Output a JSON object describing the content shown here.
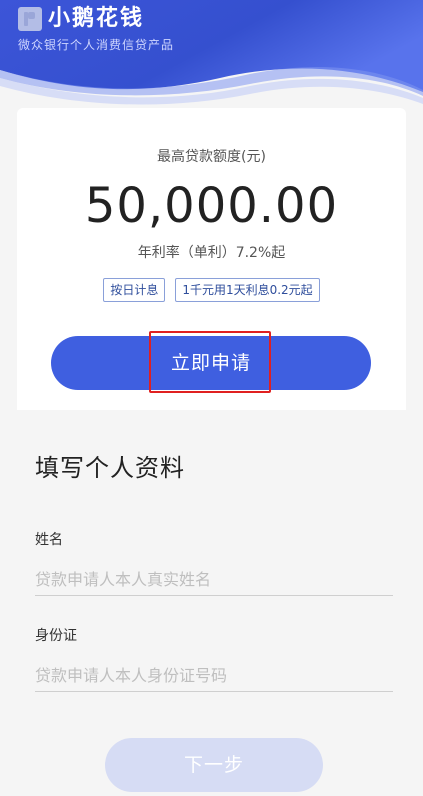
{
  "header": {
    "app_name": "小鹅花钱",
    "slogan": "微众银行个人消费信贷产品"
  },
  "loan_card": {
    "amount_label": "最高贷款额度(元)",
    "amount": "50,000.00",
    "rate_text": "年利率（单利）7.2%起",
    "tags": [
      "按日计息",
      "1千元用1天利息0.2元起"
    ],
    "apply_button": "立即申请"
  },
  "form": {
    "title": "填写个人资料",
    "name_label": "姓名",
    "name_placeholder": "贷款申请人本人真实姓名",
    "id_label": "身份证",
    "id_placeholder": "贷款申请人本人身份证号码",
    "next_button": "下一步"
  },
  "colors": {
    "brand_blue": "#3f5fe0",
    "next_disabled": "#d6dcf4",
    "highlight_red": "#e02020"
  }
}
